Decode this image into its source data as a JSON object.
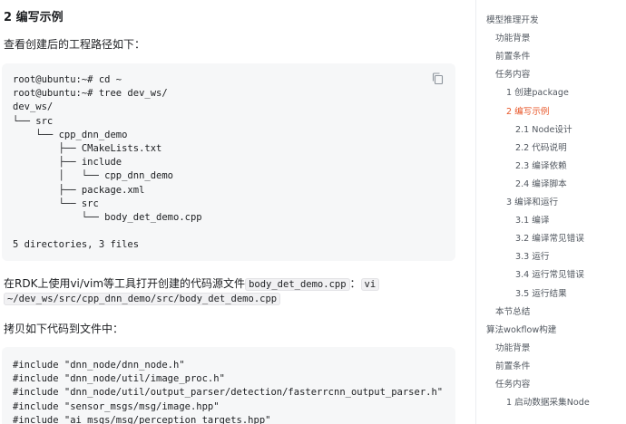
{
  "main": {
    "heading": "2 编写示例",
    "para_view_path": "查看创建后的工程路径如下：",
    "tree_code": [
      "root@ubuntu:~# cd ~",
      "root@ubuntu:~# tree dev_ws/",
      "dev_ws/",
      "└── src",
      "    └── cpp_dnn_demo",
      "        ├── CMakeLists.txt",
      "        ├── include",
      "        │   └── cpp_dnn_demo",
      "        ├── package.xml",
      "        └── src",
      "            └── body_det_demo.cpp",
      "",
      "5 directories, 3 files"
    ],
    "para_open_prefix": "在RDK上使用vi/vim等工具打开创建的代码源文件",
    "para_open_file": "body_det_demo.cpp",
    "para_open_sep": "：",
    "para_open_cmd_part1": "vi",
    "para_open_cmd_part2": "~/dev_ws/src/cpp_dnn_demo/src/body_det_demo.cpp",
    "para_copy": "拷贝如下代码到文件中：",
    "include_code": [
      "#include \"dnn_node/dnn_node.h\"",
      "#include \"dnn_node/util/image_proc.h\"",
      "#include \"dnn_node/util/output_parser/detection/fasterrcnn_output_parser.h\"",
      "#include \"sensor_msgs/msg/image.hpp\"",
      "#include \"ai_msgs/msg/perception_targets.hpp\""
    ]
  },
  "toc": {
    "items": [
      {
        "label": "模型推理开发",
        "level": 0,
        "active": false
      },
      {
        "label": "功能背景",
        "level": 1,
        "active": false
      },
      {
        "label": "前置条件",
        "level": 1,
        "active": false
      },
      {
        "label": "任务内容",
        "level": 1,
        "active": false
      },
      {
        "label": "1 创建package",
        "level": 2,
        "active": false
      },
      {
        "label": "2 编写示例",
        "level": 2,
        "active": true
      },
      {
        "label": "2.1 Node设计",
        "level": 3,
        "active": false
      },
      {
        "label": "2.2 代码说明",
        "level": 3,
        "active": false
      },
      {
        "label": "2.3 编译依赖",
        "level": 3,
        "active": false
      },
      {
        "label": "2.4 编译脚本",
        "level": 3,
        "active": false
      },
      {
        "label": "3 编译和运行",
        "level": 2,
        "active": false
      },
      {
        "label": "3.1 编译",
        "level": 3,
        "active": false
      },
      {
        "label": "3.2 编译常见错误",
        "level": 3,
        "active": false
      },
      {
        "label": "3.3 运行",
        "level": 3,
        "active": false
      },
      {
        "label": "3.4 运行常见错误",
        "level": 3,
        "active": false
      },
      {
        "label": "3.5 运行结果",
        "level": 3,
        "active": false
      },
      {
        "label": "本节总结",
        "level": 1,
        "active": false
      },
      {
        "label": "算法wokflow构建",
        "level": 0,
        "active": false
      },
      {
        "label": "功能背景",
        "level": 1,
        "active": false
      },
      {
        "label": "前置条件",
        "level": 1,
        "active": false
      },
      {
        "label": "任务内容",
        "level": 1,
        "active": false
      },
      {
        "label": "1 启动数据采集Node",
        "level": 2,
        "active": false
      }
    ]
  },
  "colors": {
    "accent": "#e8572a",
    "toc_text": "#525860",
    "code_bg": "#f6f7f8",
    "text": "#1c1e21"
  },
  "icons": {
    "copy": "copy-icon"
  }
}
